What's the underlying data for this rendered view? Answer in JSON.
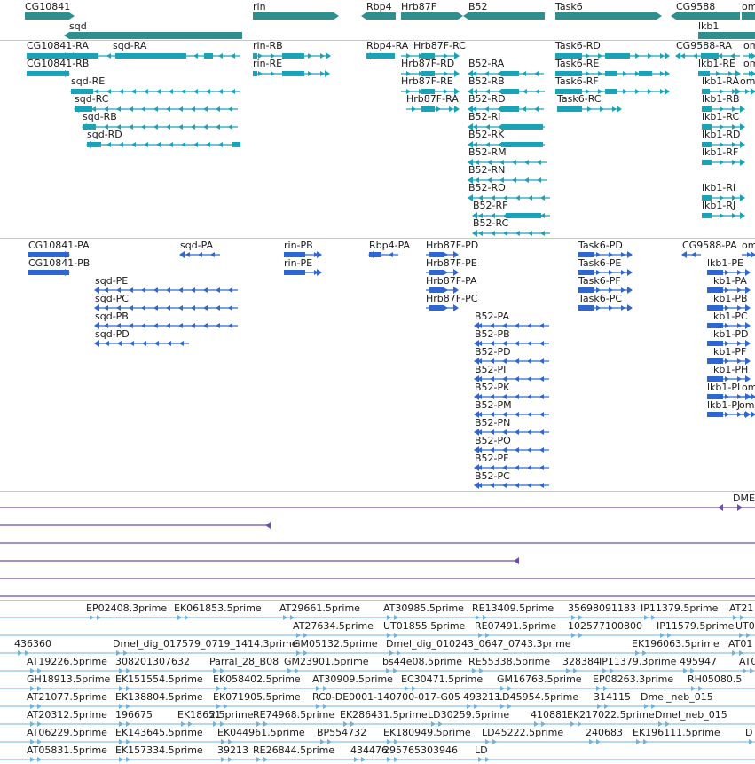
{
  "colors": {
    "gene": "#2f8f8f",
    "transcript": "#19a3b8",
    "protein": "#2f67d0",
    "alignment": "#6a4fa8",
    "est": "#6fb2dc",
    "separator": "#c8c8c8"
  },
  "gene_track": {
    "genes": [
      {
        "label": "CG10841",
        "dir": "+"
      },
      {
        "label": "sqd",
        "dir": "-"
      },
      {
        "label": "rin",
        "dir": "+"
      },
      {
        "label": "Rbp4",
        "dir": "-"
      },
      {
        "label": "Hrb87F",
        "dir": "+"
      },
      {
        "label": "B52",
        "dir": "-"
      },
      {
        "label": "Task6",
        "dir": "+"
      },
      {
        "label": "CG9588",
        "dir": "-"
      },
      {
        "label": "lkb1",
        "dir": "+"
      },
      {
        "label": "om",
        "dir": "+"
      }
    ]
  },
  "transcript_track": {
    "transcripts": [
      {
        "label": "CG10841-RA",
        "dir": "+"
      },
      {
        "label": "CG10841-RB",
        "dir": "+"
      },
      {
        "label": "sqd-RA",
        "dir": "-"
      },
      {
        "label": "sqd-RE",
        "dir": "-"
      },
      {
        "label": "sqd-RC",
        "dir": "-"
      },
      {
        "label": "sqd-RB",
        "dir": "-"
      },
      {
        "label": "sqd-RD",
        "dir": "-"
      },
      {
        "label": "rin-RB",
        "dir": "+"
      },
      {
        "label": "rin-RE",
        "dir": "+"
      },
      {
        "label": "Rbp4-RA",
        "dir": "-"
      },
      {
        "label": "Hrb87F-RC",
        "dir": "+"
      },
      {
        "label": "Hrb87F-RD",
        "dir": "+"
      },
      {
        "label": "Hrb87F-RE",
        "dir": "+"
      },
      {
        "label": "Hrb87F-RA",
        "dir": "+"
      },
      {
        "label": "B52-RA",
        "dir": "-"
      },
      {
        "label": "B52-RB",
        "dir": "-"
      },
      {
        "label": "B52-RD",
        "dir": "-"
      },
      {
        "label": "B52-RI",
        "dir": "-"
      },
      {
        "label": "B52-RK",
        "dir": "-"
      },
      {
        "label": "B52-RM",
        "dir": "-"
      },
      {
        "label": "B52-RN",
        "dir": "-"
      },
      {
        "label": "B52-RO",
        "dir": "-"
      },
      {
        "label": "B52-RF",
        "dir": "-"
      },
      {
        "label": "B52-RC",
        "dir": "-"
      },
      {
        "label": "Task6-RD",
        "dir": "+"
      },
      {
        "label": "Task6-RE",
        "dir": "+"
      },
      {
        "label": "Task6-RF",
        "dir": "+"
      },
      {
        "label": "Task6-RC",
        "dir": "+"
      },
      {
        "label": "CG9588-RA",
        "dir": "-"
      },
      {
        "label": "om",
        "dir": "+"
      },
      {
        "label": "lkb1-RE",
        "dir": "+"
      },
      {
        "label": "om",
        "dir": "+"
      },
      {
        "label": "lkb1-RA",
        "dir": "+"
      },
      {
        "label": "om",
        "dir": "+"
      },
      {
        "label": "lkb1-RB",
        "dir": "+"
      },
      {
        "label": "lkb1-RC",
        "dir": "+"
      },
      {
        "label": "lkb1-RD",
        "dir": "+"
      },
      {
        "label": "lkb1-RF",
        "dir": "+"
      },
      {
        "label": "lkb1-RI",
        "dir": "+"
      },
      {
        "label": "lkb1-RJ",
        "dir": "+"
      }
    ]
  },
  "protein_track": {
    "proteins": [
      {
        "label": "CG10841-PA",
        "dir": "+"
      },
      {
        "label": "CG10841-PB",
        "dir": "+"
      },
      {
        "label": "sqd-PA",
        "dir": "-"
      },
      {
        "label": "sqd-PE",
        "dir": "-"
      },
      {
        "label": "sqd-PC",
        "dir": "-"
      },
      {
        "label": "sqd-PB",
        "dir": "-"
      },
      {
        "label": "sqd-PD",
        "dir": "-"
      },
      {
        "label": "rin-PB",
        "dir": "+"
      },
      {
        "label": "rin-PE",
        "dir": "+"
      },
      {
        "label": "Rbp4-PA",
        "dir": "-"
      },
      {
        "label": "Hrb87F-PD",
        "dir": "+"
      },
      {
        "label": "Hrb87F-PE",
        "dir": "+"
      },
      {
        "label": "Hrb87F-PA",
        "dir": "+"
      },
      {
        "label": "Hrb87F-PC",
        "dir": "+"
      },
      {
        "label": "B52-PA",
        "dir": "-"
      },
      {
        "label": "B52-PB",
        "dir": "-"
      },
      {
        "label": "B52-PD",
        "dir": "-"
      },
      {
        "label": "B52-PI",
        "dir": "-"
      },
      {
        "label": "B52-PK",
        "dir": "-"
      },
      {
        "label": "B52-PM",
        "dir": "-"
      },
      {
        "label": "B52-PN",
        "dir": "-"
      },
      {
        "label": "B52-PO",
        "dir": "-"
      },
      {
        "label": "B52-PF",
        "dir": "-"
      },
      {
        "label": "B52-PC",
        "dir": "-"
      },
      {
        "label": "Task6-PD",
        "dir": "+"
      },
      {
        "label": "Task6-PE",
        "dir": "+"
      },
      {
        "label": "Task6-PF",
        "dir": "+"
      },
      {
        "label": "Task6-PC",
        "dir": "+"
      },
      {
        "label": "CG9588-PA",
        "dir": "-"
      },
      {
        "label": "om",
        "dir": "+"
      },
      {
        "label": "lkb1-PE",
        "dir": "+"
      },
      {
        "label": "lkb1-PA",
        "dir": "+"
      },
      {
        "label": "lkb1-PB",
        "dir": "+"
      },
      {
        "label": "lkb1-PC",
        "dir": "+"
      },
      {
        "label": "lkb1-PD",
        "dir": "+"
      },
      {
        "label": "lkb1-PF",
        "dir": "+"
      },
      {
        "label": "lkb1-PH",
        "dir": "+"
      },
      {
        "label": "lkb1-PI",
        "dir": "+"
      },
      {
        "label": "om",
        "dir": "+"
      },
      {
        "label": "lkb1-PJ",
        "dir": "+"
      },
      {
        "label": "om",
        "dir": "+"
      }
    ]
  },
  "alignment_track": {
    "alignments": [
      {
        "label": "DME"
      }
    ]
  },
  "est_track": {
    "rows": [
      [
        "EP02408.3prime",
        "EK061853.5prime",
        "AT29661.5prime",
        "AT30985.5prime",
        "RE13409.5prime",
        "35698091183",
        "IP11379.5prime",
        "AT21"
      ],
      [
        "AT27634.5prime",
        "UT01855.5prime",
        "RE07491.5prime",
        "102577100800",
        "IP11579.5prime",
        "UT0"
      ],
      [
        "436360",
        "Dmel_dig_017579_0719_1414.3prime",
        "GM05132.5prime",
        "Dmel_dig_010243_0647_0743.3prime",
        "EK196063.5prime",
        "AT01"
      ],
      [
        "AT19226.5prime",
        "308201307632",
        "Parral_28_B08",
        "GM23901.5prime",
        "bs44e08.5prime",
        "RE55338.5prime",
        "328384",
        "IP11379.3prime",
        "495947",
        "AT0"
      ],
      [
        "GH18913.5prime",
        "EK151554.5prime",
        "EK058402.5prime",
        "AT30909.5prime",
        "EC30471.5prime",
        "GM16763.5prime",
        "EP08263.3prime",
        "RH05080.5"
      ],
      [
        "AT21077.5prime",
        "EK138804.5prime",
        "EK071905.5prime",
        "RC0-DE0001-140700-017-G05",
        "493213",
        "LD45954.5prime",
        "314115",
        "Dmel_neb_015"
      ],
      [
        "AT20312.5prime",
        "196675",
        "EK18651",
        "2.5prime",
        "RE74968.5prime",
        "EK286431.5prime",
        "LD30259.5prime",
        "410881",
        "EK217022.5prime",
        "Dmel_neb_015"
      ],
      [
        "AT06229.5prime",
        "EK143645.5prime",
        "EK044961.5prime",
        "BP554732",
        "EK180949.5prime",
        "LD45222.5prime",
        "240683",
        "EK196111.5prime",
        "D"
      ],
      [
        "AT05831.5prime",
        "EK157334.5prime",
        "39213",
        "RE26844.5prime",
        "434476",
        "295765303946",
        "LD"
      ]
    ]
  }
}
